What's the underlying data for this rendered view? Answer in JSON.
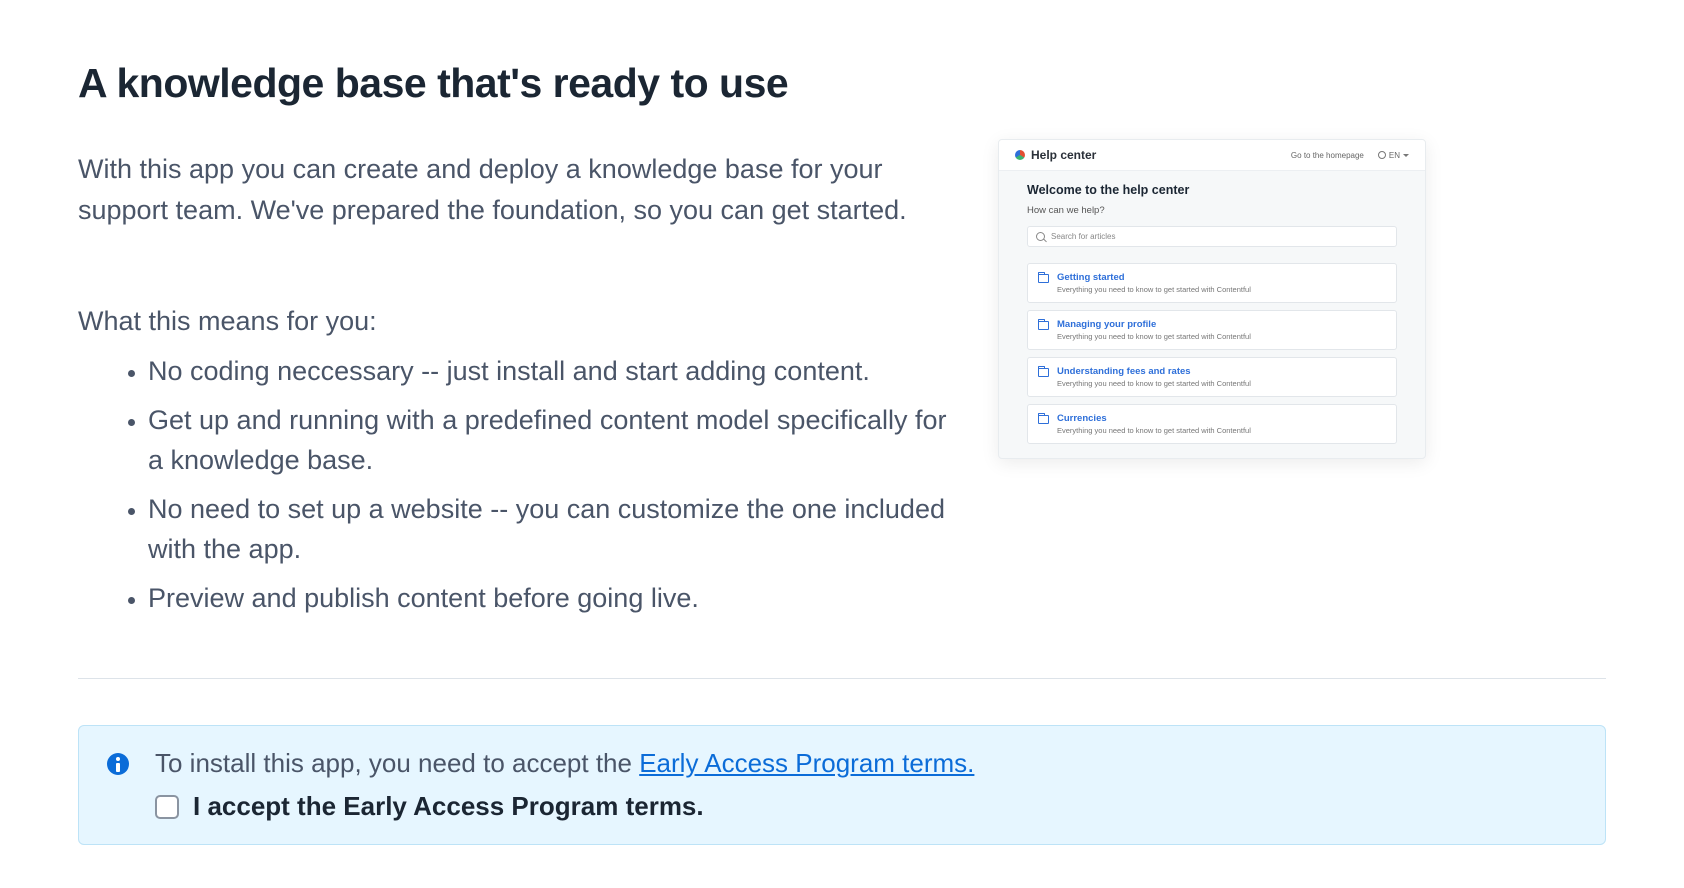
{
  "title": "A knowledge base that's ready to use",
  "intro": "With this app you can create and deploy a knowledge base for your support team. We've prepared the foundation, so you can get started.",
  "means_label": "What this means for you:",
  "bullets": [
    "No coding neccessary -- just install and start adding content.",
    "Get up and running with a predefined content model specifically for a knowledge base.",
    "No need to set up a website -- you can customize the one included with the app.",
    "Preview and publish content before going live."
  ],
  "preview": {
    "app_title": "Help center",
    "homepage_link": "Go to the homepage",
    "lang": "EN",
    "welcome": "Welcome to the help center",
    "subheading": "How can we help?",
    "search_placeholder": "Search for articles",
    "card_desc_common": "Everything you need to know to get started with Contentful",
    "cards": [
      {
        "title": "Getting started"
      },
      {
        "title": "Managing your profile"
      },
      {
        "title": "Understanding fees and rates"
      },
      {
        "title": "Currencies"
      }
    ]
  },
  "info": {
    "line1_prefix": "To install this app, you need to accept the ",
    "link_text": "Early Access Program terms.",
    "accept_label": "I accept the Early Access Program terms."
  }
}
